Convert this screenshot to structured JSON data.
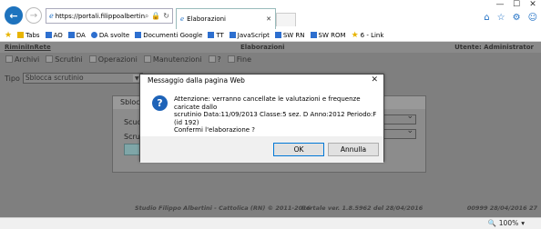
{
  "browser": {
    "url": "https://portali.filippoalbertin...",
    "tab_title": "Elaborazioni",
    "zoom": "100%"
  },
  "favorites": [
    {
      "label": "Tabs",
      "icon": "folder-icon",
      "color": "#e8b400"
    },
    {
      "label": "AO",
      "icon": "page-icon",
      "color": "#2d6fcf"
    },
    {
      "label": "DA",
      "icon": "page-icon",
      "color": "#2d6fcf"
    },
    {
      "label": "DA svolte",
      "icon": "gear-icon",
      "color": "#2d6fcf"
    },
    {
      "label": "Documenti Google",
      "icon": "page-icon",
      "color": "#2d6fcf"
    },
    {
      "label": "TT",
      "icon": "page-icon",
      "color": "#2d6fcf"
    },
    {
      "label": "JavaScript",
      "icon": "page-icon",
      "color": "#2d6fcf"
    },
    {
      "label": "SW RN",
      "icon": "page-icon",
      "color": "#2d6fcf"
    },
    {
      "label": "SW ROM",
      "icon": "page-icon",
      "color": "#2d6fcf"
    },
    {
      "label": "6 - Link",
      "icon": "star-icon",
      "color": "#e8b400"
    }
  ],
  "app": {
    "name": "RiminiInRete",
    "section": "Elaborazioni",
    "user": "Utente: Administrator",
    "menu": [
      "Archivi",
      "Scrutini",
      "Operazioni",
      "Manutenzioni",
      "?",
      "Fine"
    ],
    "tipo_label": "Tipo",
    "tipo_value": "Sblocca scrutinio",
    "inner_header": "Sblocc",
    "inner_label1": "Scuol",
    "inner_label2": "Scruti"
  },
  "footer": {
    "credits": "Studio Filippo Albertini - Cattolica (RN) © 2011-2016",
    "version": "Portale ver. 1.8.5962 del 28/04/2016",
    "right": "00999  28/04/2016  27"
  },
  "dialog": {
    "title": "Messaggio dalla pagina Web",
    "message_line1": "Attenzione: verranno cancellate le valutazioni e frequenze caricate dallo",
    "message_line2": "scrutinio Data:11/09/2013  Classe:5 sez. D  Anno:2012  Periodo:F  (id 192)",
    "message_line3": "Confermi l'elaborazione ?",
    "ok_label": "OK",
    "cancel_label": "Annulla"
  }
}
